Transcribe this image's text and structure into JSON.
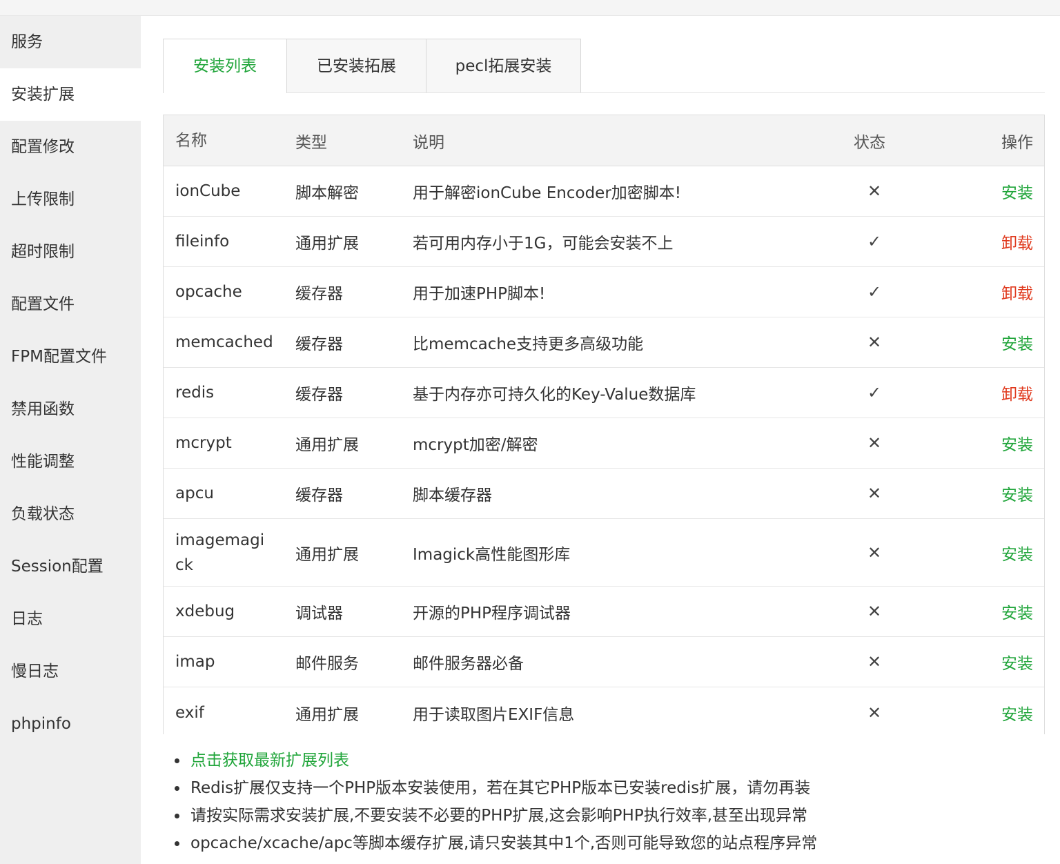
{
  "sidebar": {
    "items": [
      {
        "label": "服务"
      },
      {
        "label": "安装扩展"
      },
      {
        "label": "配置修改"
      },
      {
        "label": "上传限制"
      },
      {
        "label": "超时限制"
      },
      {
        "label": "配置文件"
      },
      {
        "label": "FPM配置文件"
      },
      {
        "label": "禁用函数"
      },
      {
        "label": "性能调整"
      },
      {
        "label": "负载状态"
      },
      {
        "label": "Session配置"
      },
      {
        "label": "日志"
      },
      {
        "label": "慢日志"
      },
      {
        "label": "phpinfo"
      }
    ],
    "active_index": 1
  },
  "tabs": [
    {
      "label": "安装列表"
    },
    {
      "label": "已安装拓展"
    },
    {
      "label": "pecl拓展安装"
    }
  ],
  "table": {
    "headers": {
      "name": "名称",
      "type": "类型",
      "desc": "说明",
      "status": "状态",
      "action": "操作"
    },
    "rows": [
      {
        "name": "ionCube",
        "type": "脚本解密",
        "desc": "用于解密ionCube Encoder加密脚本!",
        "status": "✕",
        "action": "安装"
      },
      {
        "name": "fileinfo",
        "type": "通用扩展",
        "desc": "若可用内存小于1G，可能会安装不上",
        "status": "✓",
        "action": "卸载"
      },
      {
        "name": "opcache",
        "type": "缓存器",
        "desc": "用于加速PHP脚本!",
        "status": "✓",
        "action": "卸载"
      },
      {
        "name": "memcached",
        "type": "缓存器",
        "desc": "比memcache支持更多高级功能",
        "status": "✕",
        "action": "安装"
      },
      {
        "name": "redis",
        "type": "缓存器",
        "desc": "基于内存亦可持久化的Key-Value数据库",
        "status": "✓",
        "action": "卸载"
      },
      {
        "name": "mcrypt",
        "type": "通用扩展",
        "desc": "mcrypt加密/解密",
        "status": "✕",
        "action": "安装"
      },
      {
        "name": "apcu",
        "type": "缓存器",
        "desc": "脚本缓存器",
        "status": "✕",
        "action": "安装"
      },
      {
        "name": "imagemagick",
        "type": "通用扩展",
        "desc": "Imagick高性能图形库",
        "status": "✕",
        "action": "安装"
      },
      {
        "name": "xdebug",
        "type": "调试器",
        "desc": "开源的PHP程序调试器",
        "status": "✕",
        "action": "安装"
      },
      {
        "name": "imap",
        "type": "邮件服务",
        "desc": "邮件服务器必备",
        "status": "✕",
        "action": "安装"
      },
      {
        "name": "exif",
        "type": "通用扩展",
        "desc": "用于读取图片EXIF信息",
        "status": "✕",
        "action": "安装"
      }
    ]
  },
  "notes": {
    "link": "点击获取最新扩展列表",
    "items": [
      "Redis扩展仅支持一个PHP版本安装使用，若在其它PHP版本已安装redis扩展，请勿再装",
      "请按实际需求安装扩展,不要安装不必要的PHP扩展,这会影响PHP执行效率,甚至出现异常",
      "opcache/xcache/apc等脚本缓存扩展,请只安装其中1个,否则可能导致您的站点程序异常"
    ]
  },
  "colors": {
    "accent": "#20a53a",
    "danger": "#e03a1e",
    "sidebar_bg": "#efefef"
  }
}
